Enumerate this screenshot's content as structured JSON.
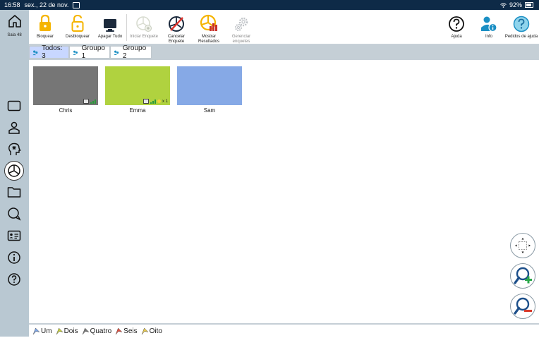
{
  "status": {
    "time": "16:58",
    "date": "sex., 22 de nov.",
    "battery": "92%"
  },
  "sidebar": {
    "home_label": "Sala 48"
  },
  "toolbar": {
    "lock": "Bloquear",
    "unlock": "Desbloquear",
    "blank": "Apagar Tudo",
    "start_poll": "Iniciar Enquete",
    "cancel_poll_1": "Cancelar",
    "cancel_poll_2": "Enquete",
    "show_results_1": "Mostrar",
    "show_results_2": "Resultados",
    "manage_polls_1": "Gerenciar",
    "manage_polls_2": "enquetes",
    "help": "Ajuda",
    "info": "Info",
    "help_requests": "Pedidos de ajuda"
  },
  "groups": [
    {
      "label": "Todos: 3",
      "active": true
    },
    {
      "label": "Groupo 1",
      "active": false
    },
    {
      "label": "Groupo 2",
      "active": false
    }
  ],
  "students": [
    {
      "name": "Chris",
      "color": "#767676",
      "extra": ""
    },
    {
      "name": "Emma",
      "color": "#b0d23f",
      "extra": "x 1"
    },
    {
      "name": "Sam",
      "color": "#86a9e6",
      "extra": ""
    }
  ],
  "stickers": [
    {
      "label": "Um",
      "color": "#7da6e8"
    },
    {
      "label": "Dois",
      "color": "#c8d23a"
    },
    {
      "label": "Quatro",
      "color": "#7a7a7a"
    },
    {
      "label": "Seis",
      "color": "#e05040"
    },
    {
      "label": "Oito",
      "color": "#e7c84a"
    }
  ],
  "colors": {
    "sidebar": "#b9c8d2",
    "statusbar": "#0e2a47",
    "accent_blue": "#1b8fc4",
    "lock_yellow": "#f5b400"
  }
}
